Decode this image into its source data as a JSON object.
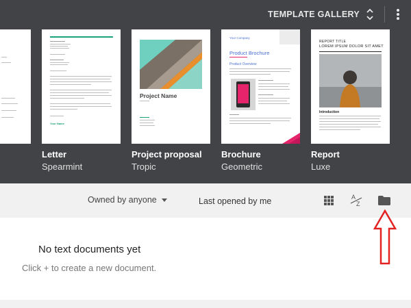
{
  "gallery": {
    "toggle_label": "TEMPLATE GALLERY",
    "templates": [
      {
        "name": "Letter",
        "style": "Spearmint"
      },
      {
        "name": "Project proposal",
        "style": "Tropic"
      },
      {
        "name": "Brochure",
        "style": "Geometric"
      },
      {
        "name": "Report",
        "style": "Luxe"
      }
    ],
    "thumbs": {
      "letter": {
        "bottom_text": "Your Name"
      },
      "proposal": {
        "title": "Project Name"
      },
      "brochure": {
        "company": "Your Company",
        "title": "Product Brochure",
        "section": "Product Overview"
      },
      "report": {
        "title": "REPORT TITLE",
        "subtitle": "LOREM IPSUM DOLOR SIT AMET",
        "section": "Introduction"
      }
    }
  },
  "toolbar": {
    "owner_filter": "Owned by anyone",
    "sort_label": "Last opened by me"
  },
  "empty_state": {
    "title": "No text documents yet",
    "subtitle": "Click + to create a new document."
  },
  "colors": {
    "gallery_bg": "#424347",
    "accent_red": "#e32222",
    "spearmint": "#1aa37a",
    "brochure_blue": "#4a6fd1",
    "brochure_pink": "#e5246b"
  }
}
